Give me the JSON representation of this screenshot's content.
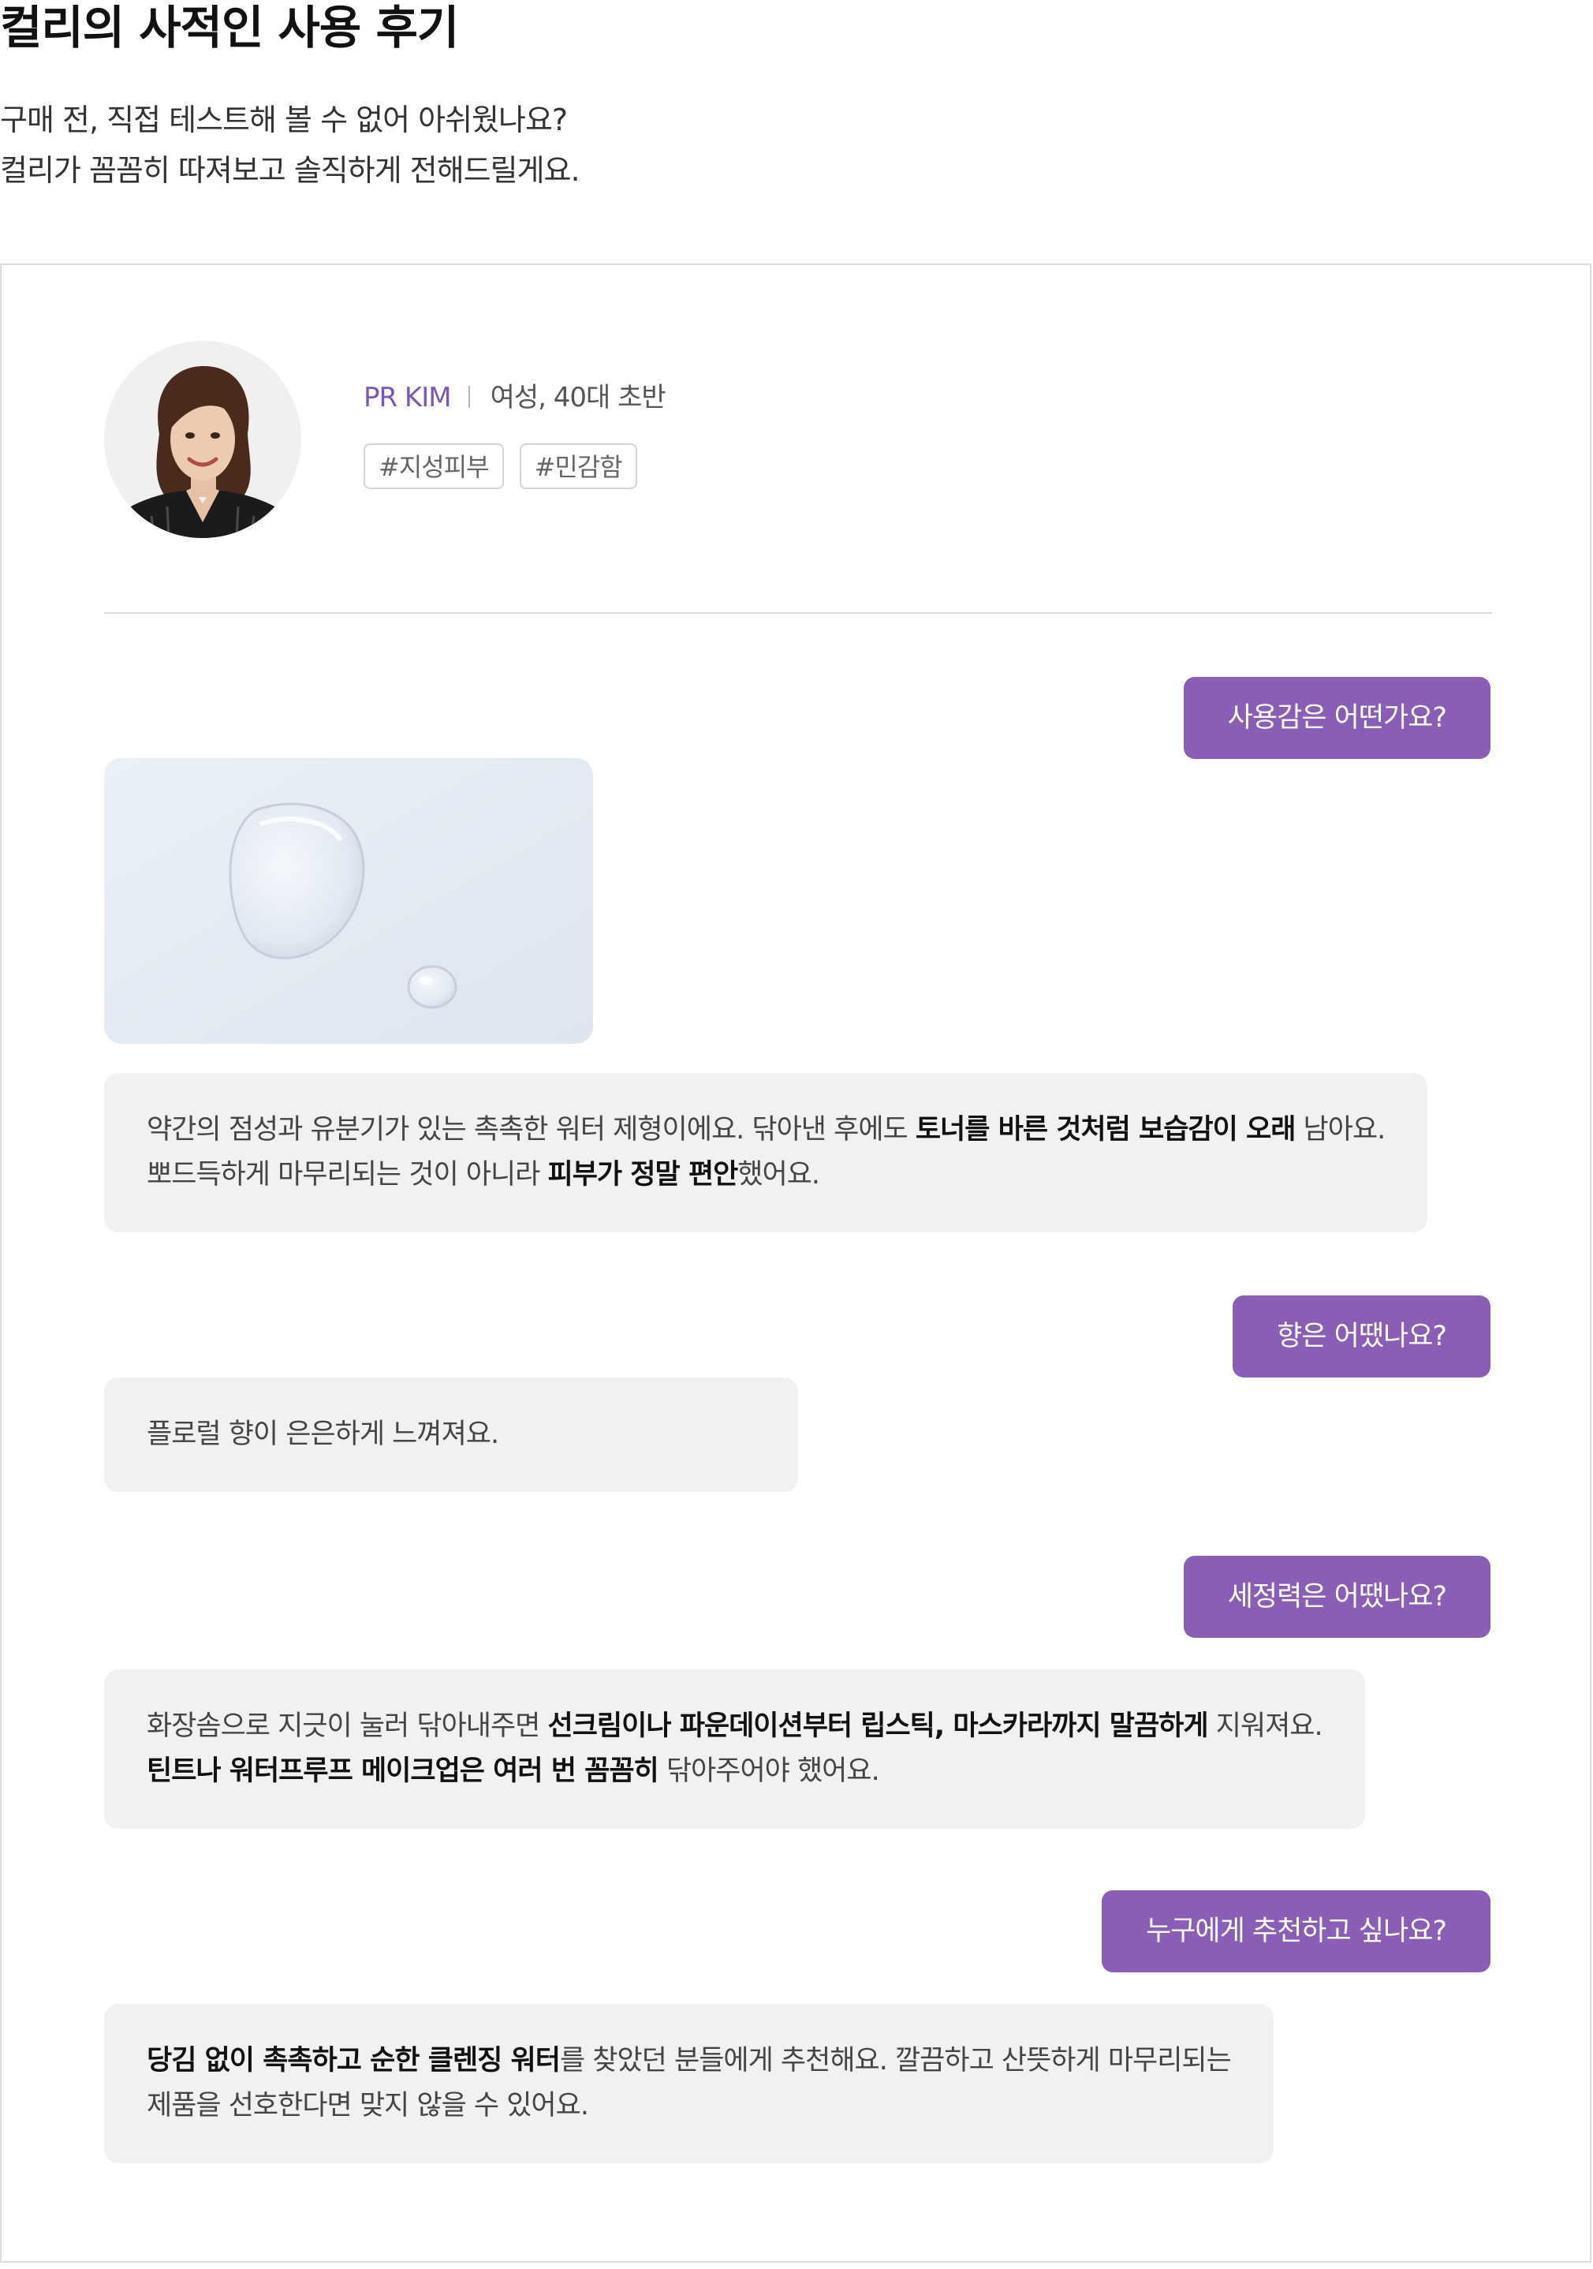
{
  "page": {
    "title": "컬리의 사적인 사용 후기",
    "intro": [
      "구매 전, 직접 테스트해 볼 수 없어 아쉬웠나요?",
      "컬리가 꼼꼼히 따져보고 솔직하게 전해드릴게요."
    ]
  },
  "reviewer": {
    "name": "PR KIM",
    "meta": "여성, 40대 초반",
    "tags": [
      "#지성피부",
      "#민감함"
    ]
  },
  "qa": [
    {
      "question": "사용감은 어떤가요?",
      "answer_lines": [
        [
          [
            "약간의 점성과 유분기가 있는 촉촉한 워터 제형이에요. 닦아낸 후에도 ",
            false
          ],
          [
            "토너를 바른 것처럼 보습감이 오래",
            true
          ],
          [
            " 남아요.",
            false
          ]
        ],
        [
          [
            "뽀드득하게 마무리되는 것이 아니라 ",
            false
          ],
          [
            "피부가 정말 편안",
            true
          ],
          [
            "했어요.",
            false
          ]
        ]
      ]
    },
    {
      "question": "향은 어땠나요?",
      "answer_lines": [
        [
          [
            "플로럴 향이 은은하게 느껴져요.",
            false
          ]
        ]
      ]
    },
    {
      "question": "세정력은 어땠나요?",
      "answer_lines": [
        [
          [
            "화장솜으로 지긋이 눌러 닦아내주면 ",
            false
          ],
          [
            "선크림이나 파운데이션부터 립스틱, 마스카라까지 말끔하게",
            true
          ],
          [
            " 지워져요.",
            false
          ]
        ],
        [
          [
            "틴트나 워터프루프 메이크업은 여러 번 꼼꼼히",
            true
          ],
          [
            " 닦아주어야 했어요.",
            false
          ]
        ]
      ]
    },
    {
      "question": "누구에게 추천하고 싶나요?",
      "answer_lines": [
        [
          [
            "당김 없이 촉촉하고 순한 클렌징 워터",
            true
          ],
          [
            "를 찾았던 분들에게 추천해요. 깔끔하고 산뜻하게 마무리되는",
            false
          ]
        ],
        [
          [
            "제품을 선호한다면 맞지 않을 수 있어요.",
            false
          ]
        ]
      ]
    }
  ],
  "colors": {
    "accent": "#8a5db7",
    "name": "#7c57b5",
    "answer_bg": "#f1f1f1",
    "border": "#dcdcdc"
  },
  "icons": {
    "avatar": "reviewer-photo",
    "product_image": "water-texture-photo"
  }
}
